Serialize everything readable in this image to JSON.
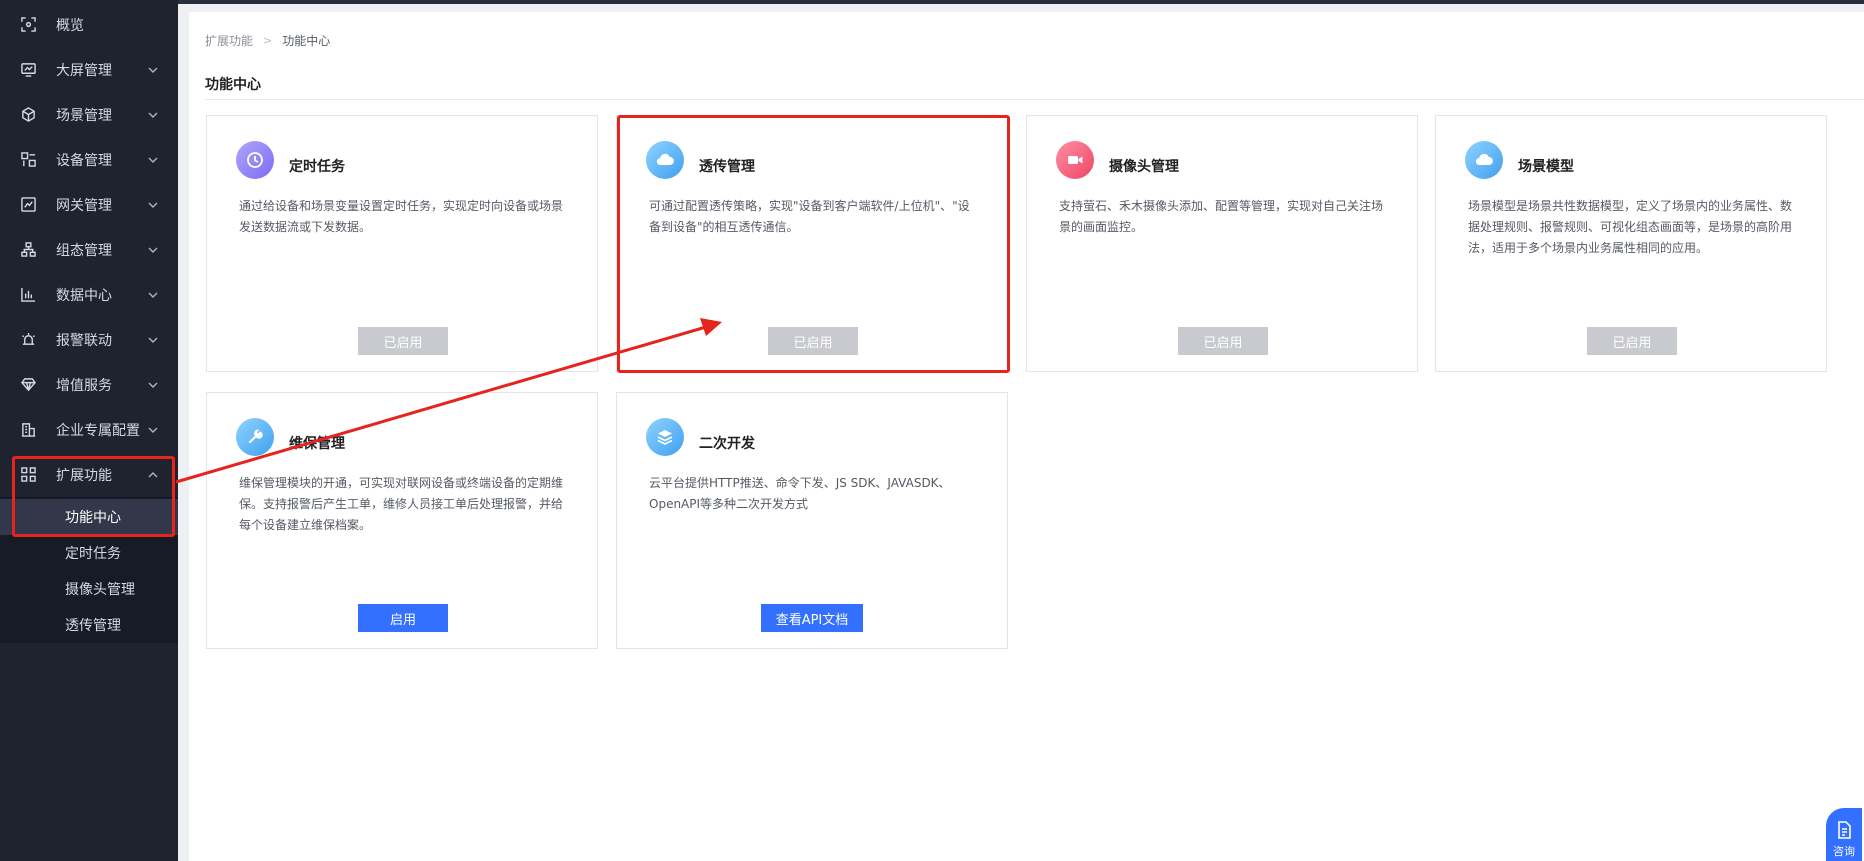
{
  "sidebar": {
    "items": [
      {
        "label": "概览",
        "icon": "overview-icon"
      },
      {
        "label": "大屏管理",
        "icon": "monitor-icon"
      },
      {
        "label": "场景管理",
        "icon": "cube-icon"
      },
      {
        "label": "设备管理",
        "icon": "device-icon"
      },
      {
        "label": "网关管理",
        "icon": "gateway-icon"
      },
      {
        "label": "组态管理",
        "icon": "topology-icon"
      },
      {
        "label": "数据中心",
        "icon": "bar-chart-icon"
      },
      {
        "label": "报警联动",
        "icon": "alarm-icon"
      },
      {
        "label": "增值服务",
        "icon": "diamond-icon"
      },
      {
        "label": "企业专属配置",
        "icon": "building-icon"
      },
      {
        "label": "扩展功能",
        "icon": "grid-icon"
      }
    ],
    "submenu": [
      {
        "label": "功能中心",
        "active": true
      },
      {
        "label": "定时任务"
      },
      {
        "label": "摄像头管理"
      },
      {
        "label": "透传管理"
      }
    ]
  },
  "breadcrumb": {
    "parent": "扩展功能",
    "separator": ">",
    "current": "功能中心"
  },
  "page_title": "功能中心",
  "cards": [
    {
      "title": "定时任务",
      "icon": "clock-icon",
      "icon_color": "#8b7cf6",
      "description": "通过给设备和场景变量设置定时任务，实现定时向设备或场景发送数据流或下发数据。",
      "button": "已启用",
      "button_state": "disabled"
    },
    {
      "title": "透传管理",
      "icon": "cloud-icon",
      "icon_color": "#3fa9f5",
      "description": "可通过配置透传策略，实现\"设备到客户端软件/上位机\"、\"设备到设备\"的相互透传通信。",
      "button": "已启用",
      "button_state": "disabled"
    },
    {
      "title": "摄像头管理",
      "icon": "camera-icon",
      "icon_color": "#f0506e",
      "description": "支持萤石、禾木摄像头添加、配置等管理，实现对自己关注场景的画面监控。",
      "button": "已启用",
      "button_state": "disabled"
    },
    {
      "title": "场景模型",
      "icon": "cloud-icon",
      "icon_color": "#3fa9f5",
      "description": "场景模型是场景共性数据模型，定义了场景内的业务属性、数据处理规则、报警规则、可视化组态画面等，是场景的高阶用法，适用于多个场景内业务属性相同的应用。",
      "button": "已启用",
      "button_state": "disabled"
    },
    {
      "title": "维保管理",
      "icon": "wrench-icon",
      "icon_color": "#3fa9f5",
      "description": "维保管理模块的开通，可实现对联网设备或终端设备的定期维保。支持报警后产生工单，维修人员接工单后处理报警，并给每个设备建立维保档案。",
      "button": "启用",
      "button_state": "primary"
    },
    {
      "title": "二次开发",
      "icon": "layers-icon",
      "icon_color": "#3fa9f5",
      "description": "云平台提供HTTP推送、命令下发、JS SDK、JAVASDK、OpenAPI等多种二次开发方式",
      "button": "查看API文档",
      "button_state": "primary"
    }
  ],
  "help_button": {
    "label": "咨询",
    "icon": "document-icon"
  },
  "colors": {
    "sidebar_bg": "#1f2330",
    "primary": "#3370ff",
    "disabled": "#c8cacf",
    "annotation": "#e5241e"
  }
}
